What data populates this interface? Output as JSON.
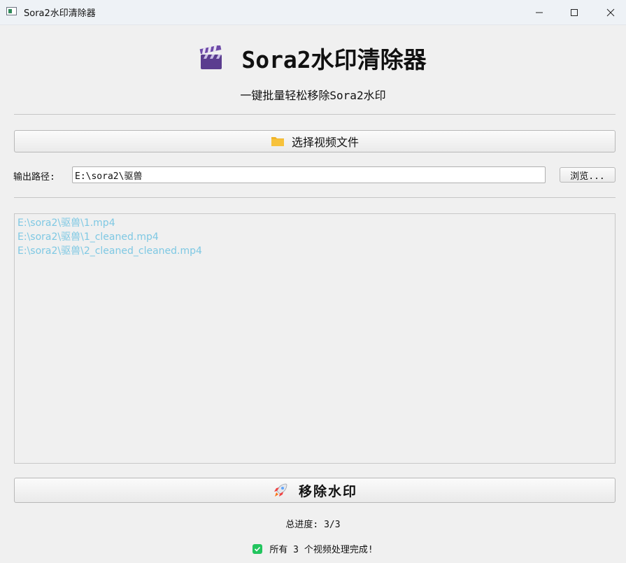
{
  "window": {
    "title": "Sora2水印清除器",
    "icon": "app-window-icon"
  },
  "header": {
    "icon": "clapperboard-icon",
    "title": "Sora2水印清除器",
    "subtitle": "一键批量轻松移除Sora2水印"
  },
  "select_button": {
    "icon": "folder-icon",
    "label": "选择视频文件"
  },
  "output": {
    "label": "输出路径:",
    "value": "E:\\sora2\\驱兽",
    "browse_label": "浏览..."
  },
  "files": [
    "E:\\sora2\\驱兽\\1.mp4",
    "E:\\sora2\\驱兽\\1_cleaned.mp4",
    "E:\\sora2\\驱兽\\2_cleaned_cleaned.mp4"
  ],
  "remove_button": {
    "icon": "rocket-icon",
    "label": "移除水印"
  },
  "progress": {
    "text": "总进度: 3/3",
    "done": 3,
    "total": 3
  },
  "status": {
    "icon": "check-icon",
    "text": "所有 3 个视频处理完成!"
  },
  "colors": {
    "file_text": "#7ec8e3",
    "check": "#22c55e",
    "clapper": "#5b3d8f",
    "folder": "#f7c23c"
  }
}
